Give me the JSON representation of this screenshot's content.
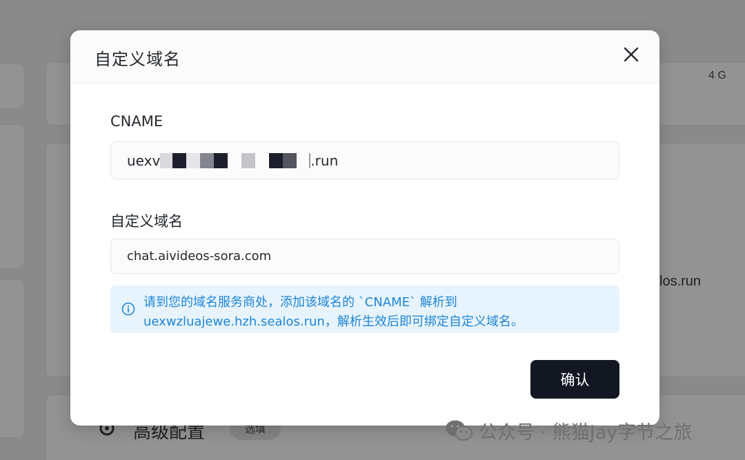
{
  "background": {
    "memory_value": "4 G",
    "domain_fragment": "los.run",
    "advanced_config_label": "高级配置",
    "optional_badge": "选填"
  },
  "modal": {
    "title": "自定义域名",
    "close_icon": "close-icon",
    "cname_label": "CNAME",
    "cname_value_prefix": "uexv",
    "cname_value_suffix": ".run",
    "custom_domain_label": "自定义域名",
    "custom_domain_value": "chat.aivideos-sora.com",
    "info_icon": "info-icon",
    "info_line1": "请到您的域名服务商处，添加该域名的 `CNAME` 解析到",
    "info_line2": "uexwzluajewe.hzh.sealos.run，解析生效后即可绑定自定义域名。",
    "confirm_label": "确认"
  },
  "watermark": {
    "text": "公众号 · 熊猫Jay字节之旅",
    "icon": "wechat-icon"
  },
  "colors": {
    "info_text": "#1f84d8",
    "info_bg": "#e7f4fe",
    "button_bg": "#121722"
  }
}
